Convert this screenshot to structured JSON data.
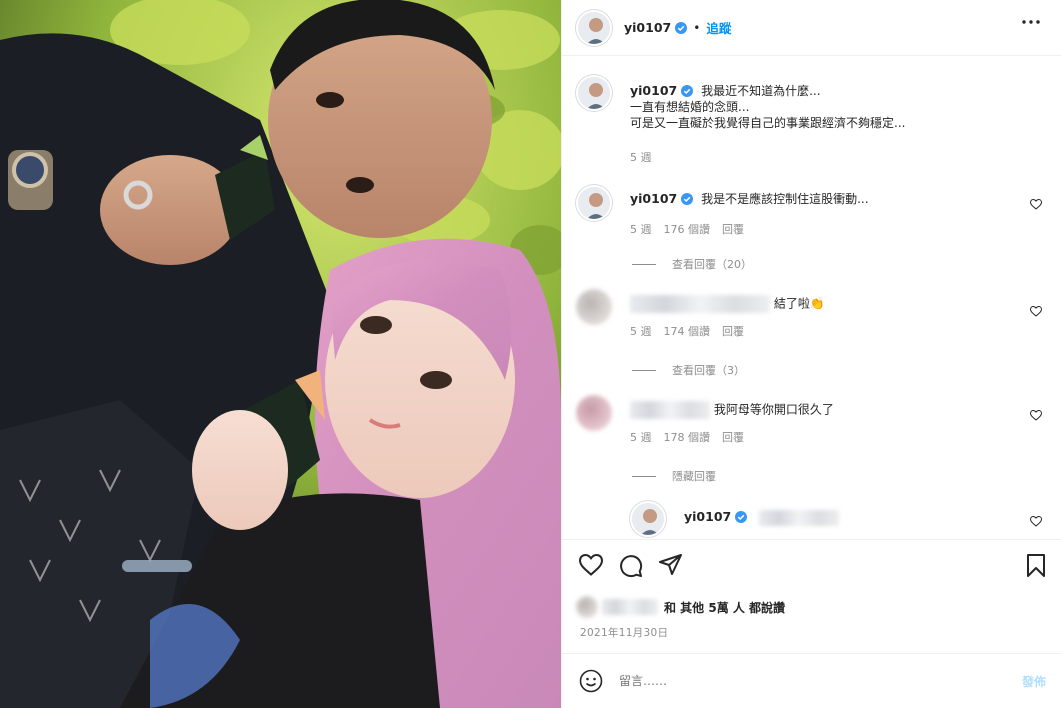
{
  "post": {
    "username": "yi0107",
    "follow_label": "追蹤",
    "more_icon": "more-horizontal-icon",
    "photo_alt": "selfie-photo"
  },
  "caption": {
    "username": "yi0107",
    "lines": [
      "我最近不知道為什麼...",
      "一直有想結婚的念頭...",
      "可是又一直礙於我覺得自己的事業跟經濟不夠穩定..."
    ],
    "time": "5 週"
  },
  "comments": [
    {
      "username": "yi0107",
      "text": "我是不是應該控制住這股衝動...",
      "time": "5 週",
      "likes": "176 個讚",
      "reply": "回覆",
      "view_replies": "查看回覆（20）"
    },
    {
      "username": "",
      "text": "結了啦👏",
      "time": "5 週",
      "likes": "174 個讚",
      "reply": "回覆",
      "view_replies": "查看回覆（3）"
    },
    {
      "username": "",
      "text": "我阿母等你開口很久了",
      "time": "5 週",
      "likes": "178 個讚",
      "reply": "回覆",
      "view_replies": "隱藏回覆"
    }
  ],
  "nested_reply": {
    "username": "yi0107"
  },
  "likes_summary": {
    "text": "和 其他 5萬 人 都說讚"
  },
  "date": "2021年11月30日",
  "add_comment": {
    "placeholder": "留言……",
    "post_label": "發佈"
  },
  "colors": {
    "accent": "#0095f6",
    "verified": "#3897f0",
    "muted": "#8e8e8e",
    "divider": "#efefef"
  }
}
